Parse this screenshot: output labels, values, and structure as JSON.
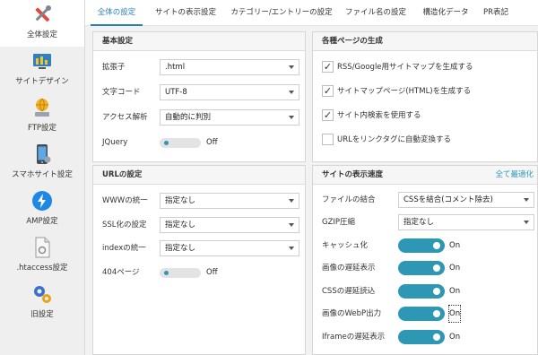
{
  "sidebar": {
    "items": [
      {
        "label": "全体設定",
        "icon": "tools-icon"
      },
      {
        "label": "サイトデザイン",
        "icon": "design-icon"
      },
      {
        "label": "FTP設定",
        "icon": "ftp-icon"
      },
      {
        "label": "スマホサイト設定",
        "icon": "smartphone-icon"
      },
      {
        "label": "AMP設定",
        "icon": "amp-icon"
      },
      {
        "label": ".htaccess設定",
        "icon": "htaccess-file-icon"
      },
      {
        "label": "旧設定",
        "icon": "gears-icon"
      }
    ]
  },
  "tabs": [
    "全体の設定",
    "サイトの表示設定",
    "カテゴリー/エントリーの設定",
    "ファイル名の設定",
    "構造化データ",
    "PR表記"
  ],
  "basic": {
    "title": "基本設定",
    "rows": [
      {
        "label": "拡張子",
        "value": ".html"
      },
      {
        "label": "文字コード",
        "value": "UTF-8"
      },
      {
        "label": "アクセス解析",
        "value": "自動的に判別"
      }
    ],
    "jquery": {
      "label": "JQuery",
      "value": "Off"
    }
  },
  "url": {
    "title": "URLの設定",
    "rows": [
      {
        "label": "WWWの統一",
        "value": "指定なし"
      },
      {
        "label": "SSL化の設定",
        "value": "指定なし"
      },
      {
        "label": "indexの統一",
        "value": "指定なし"
      }
    ],
    "page404": {
      "label": "404ページ",
      "value": "Off"
    }
  },
  "pages": {
    "title": "各種ページの生成",
    "checks": [
      {
        "label": "RSS/Google用サイトマップを生成する",
        "checked": true,
        "mark": "✓"
      },
      {
        "label": "サイトマップページ(HTML)を生成する",
        "checked": true,
        "mark": "✓"
      },
      {
        "label": "サイト内検索を使用する",
        "checked": true,
        "mark": "✓"
      },
      {
        "label": "URLをリンクタグに自動変換する",
        "checked": false,
        "mark": ""
      }
    ]
  },
  "speed": {
    "title": "サイトの表示速度",
    "optimize_link": "全て最適化",
    "selects": [
      {
        "label": "ファイルの結合",
        "value": "CSSを結合(コメント除去)"
      },
      {
        "label": "GZIP圧縮",
        "value": "指定なし"
      }
    ],
    "toggles": [
      {
        "label": "キャッシュ化",
        "value": "On"
      },
      {
        "label": "画像の遅延表示",
        "value": "On"
      },
      {
        "label": "CSSの遅延読込",
        "value": "On"
      },
      {
        "label": "画像のWebP出力",
        "value": "On"
      },
      {
        "label": "Iframeの遅延表示",
        "value": "On"
      }
    ]
  },
  "colors": {
    "accent": "#2e97b4",
    "tab_active": "#2b7fb8"
  }
}
